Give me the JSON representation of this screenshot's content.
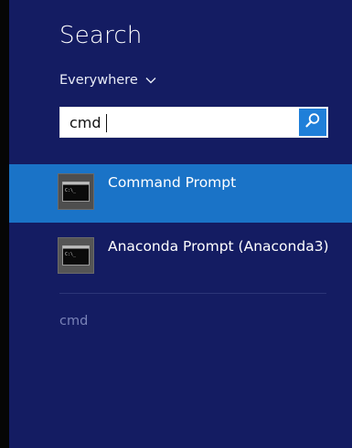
{
  "search": {
    "title": "Search",
    "scope": "Everywhere",
    "query": "cmd"
  },
  "results": [
    {
      "label": "Command Prompt",
      "selected": true,
      "icon": "command-prompt-icon"
    },
    {
      "label": "Anaconda Prompt (Anaconda3)",
      "selected": false,
      "icon": "anaconda-prompt-icon"
    }
  ],
  "suggestions": [
    {
      "label": "cmd"
    }
  ],
  "colors": {
    "pane_background": "#141c62",
    "selected_result": "#1a73c7",
    "search_button": "#1f7fd9",
    "suggestion_text": "#7a83b8"
  }
}
